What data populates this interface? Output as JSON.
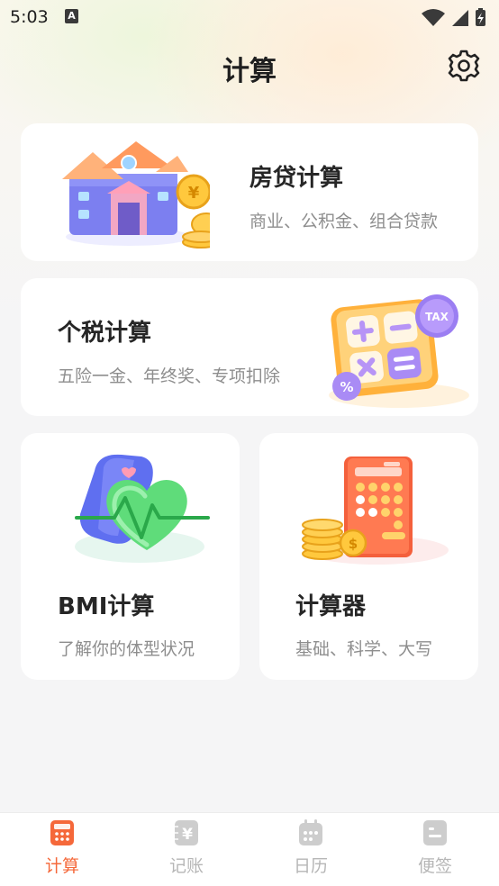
{
  "status_bar": {
    "time": "5:03",
    "notification_icon": "A"
  },
  "header": {
    "title": "计算",
    "settings_icon": "gear-icon"
  },
  "cards": {
    "mortgage": {
      "title": "房贷计算",
      "subtitle": "商业、公积金、组合贷款",
      "icon": "house-coins-icon"
    },
    "tax": {
      "title": "个税计算",
      "subtitle": "五险一金、年终奖、专项扣除",
      "icon": "tax-calculator-icon",
      "badge": "TAX"
    },
    "bmi": {
      "title": "BMI计算",
      "subtitle": "了解你的体型状况",
      "icon": "heart-watch-icon"
    },
    "calculator": {
      "title": "计算器",
      "subtitle": "基础、科学、大写",
      "icon": "calculator-coins-icon"
    }
  },
  "bottom_nav": {
    "items": [
      {
        "label": "计算",
        "icon": "calculator-icon",
        "active": true
      },
      {
        "label": "记账",
        "icon": "yuan-ledger-icon",
        "active": false
      },
      {
        "label": "日历",
        "icon": "calendar-icon",
        "active": false
      },
      {
        "label": "便签",
        "icon": "note-icon",
        "active": false
      }
    ]
  },
  "colors": {
    "accent": "#f5683a",
    "inactive": "#b6b6b6",
    "background": "#f5f5f6",
    "card": "#ffffff"
  }
}
